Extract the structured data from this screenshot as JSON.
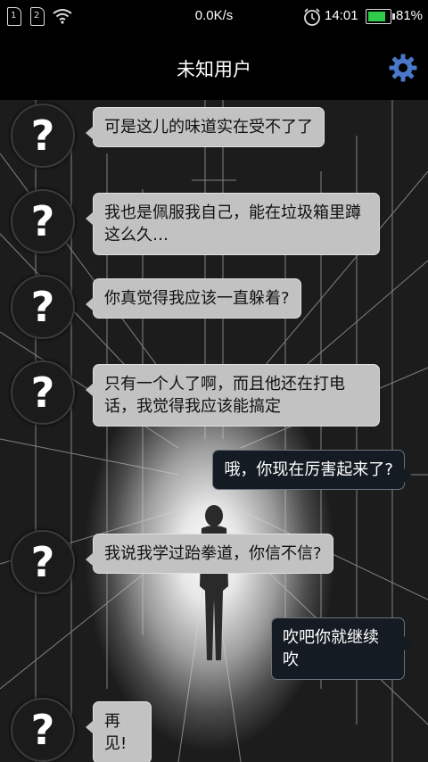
{
  "status_bar": {
    "sim1_label": "1",
    "sim2_label": "2",
    "net_speed": "0.0K/s",
    "time": "14:01",
    "battery_percent": "81%",
    "battery_level": 0.81,
    "battery_color": "#2ecc4a"
  },
  "header": {
    "title": "未知用户",
    "settings_icon": "gear-icon",
    "accent_color": "#4a78c8"
  },
  "messages": [
    {
      "side": "in",
      "text": "可是这儿的味道实在受不了了"
    },
    {
      "side": "in",
      "text": "我也是佩服我自己，能在垃圾箱里蹲这么久…"
    },
    {
      "side": "in",
      "text": "你真觉得我应该一直躲着?"
    },
    {
      "side": "in",
      "text": "只有一个人了啊，而且他还在打电话，我觉得我应该能搞定"
    },
    {
      "side": "out",
      "text": "哦，你现在厉害起来了?"
    },
    {
      "side": "in",
      "text": "我说我学过跆拳道，你信不信?"
    },
    {
      "side": "out",
      "text": "吹吧你就继续吹"
    },
    {
      "side": "in",
      "text": "再见!"
    }
  ],
  "avatar_glyph": "?"
}
